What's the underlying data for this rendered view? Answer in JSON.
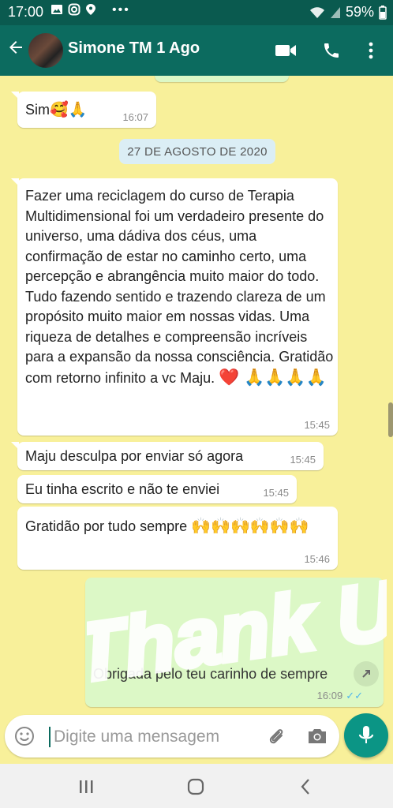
{
  "status_bar": {
    "time": "17:00",
    "battery": "59%"
  },
  "header": {
    "contact_name": "Simone TM 1 Ago",
    "icons": [
      "back-arrow-icon",
      "video-call-icon",
      "phone-call-icon",
      "more-options-icon"
    ]
  },
  "chat": {
    "date_divider": "27 DE AGOSTO DE 2020",
    "messages": [
      {
        "text": "Sim",
        "emoji": "🥰🙏",
        "time": "16:07",
        "direction": "in"
      },
      {
        "text": "Fazer uma reciclagem do curso de Terapia Multidimensional foi um verdadeiro presente do universo, uma dádiva dos céus, uma confirmação de estar no caminho certo, uma percepção e abrangência muito maior do todo. Tudo fazendo sentido e trazendo clareza de um propósito muito maior em nossas vidas. Uma riqueza de detalhes e compreensão incríveis para a expansão da nossa consciência. Gratidão com retorno infinito a vc Maju.",
        "emoji": "❤️ 🙏🙏🙏🙏",
        "time": "15:45",
        "direction": "in"
      },
      {
        "text": "Maju desculpa por enviar só agora",
        "time": "15:45",
        "direction": "in"
      },
      {
        "text": "Eu tinha escrito e não te enviei",
        "time": "15:45",
        "direction": "in"
      },
      {
        "text": "Gratidão por tudo sempre",
        "emoji": "🙌🙌🙌🙌🙌🙌",
        "time": "15:46",
        "direction": "in"
      },
      {
        "text": "Obrigada pelo teu carinho de sempre",
        "time": "16:09",
        "direction": "out"
      }
    ],
    "sticker_text": "Thank U"
  },
  "composer": {
    "placeholder": "Digite uma mensagem"
  },
  "colors": {
    "header": "#0c6b5f",
    "status_bar": "#0a5a4f",
    "wallpaper": "#f8f09a",
    "mic_button": "#0b9585"
  }
}
